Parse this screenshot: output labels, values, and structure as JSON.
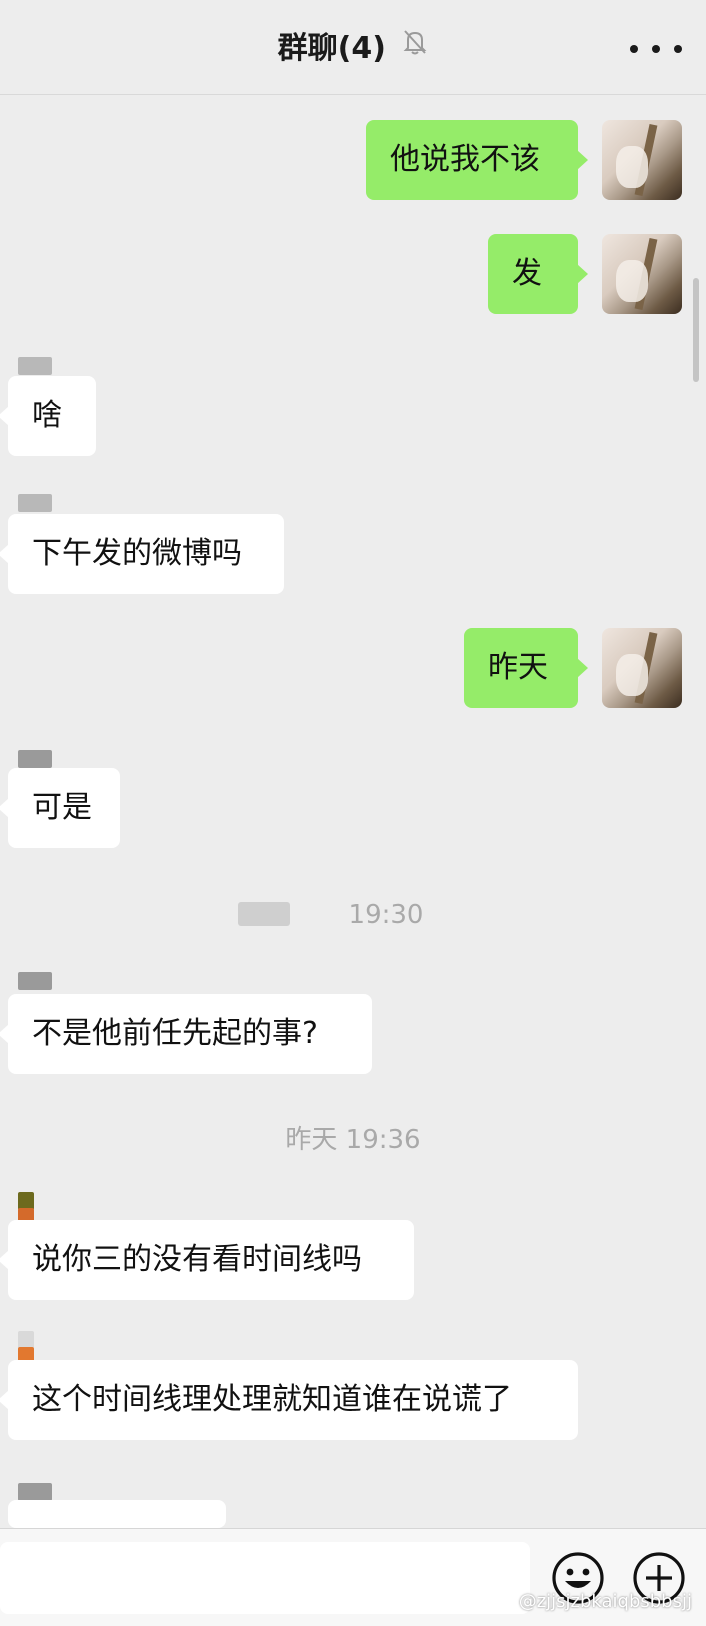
{
  "header": {
    "title": "群聊(4)",
    "mute_icon": "bell-off-icon",
    "more_icon": "more-dots-icon"
  },
  "messages": [
    {
      "side": "me",
      "text": "他说我不该"
    },
    {
      "side": "me",
      "text": "发"
    },
    {
      "side": "other",
      "text": "啥"
    },
    {
      "side": "other",
      "text": "下午发的微博吗"
    },
    {
      "side": "me",
      "text": "昨天"
    },
    {
      "side": "other",
      "text": "可是"
    },
    {
      "side": "other",
      "text": "不是他前任先起的事?"
    },
    {
      "side": "other",
      "text": "说你三的没有看时间线吗"
    },
    {
      "side": "other",
      "text": "这个时间线理处理就知道谁在说谎了"
    }
  ],
  "timestamps": [
    {
      "text": "19:30"
    },
    {
      "text": "昨天 19:36"
    }
  ],
  "input_bar": {
    "placeholder": "",
    "emoji_icon": "emoji-icon",
    "plus_icon": "plus-icon"
  },
  "watermark": "@zjjsjzbkaiqbsbbsjj",
  "colors": {
    "background": "#ededed",
    "my_bubble": "#95ec69",
    "other_bubble": "#ffffff",
    "timestamp_text": "#a9a9a9"
  }
}
